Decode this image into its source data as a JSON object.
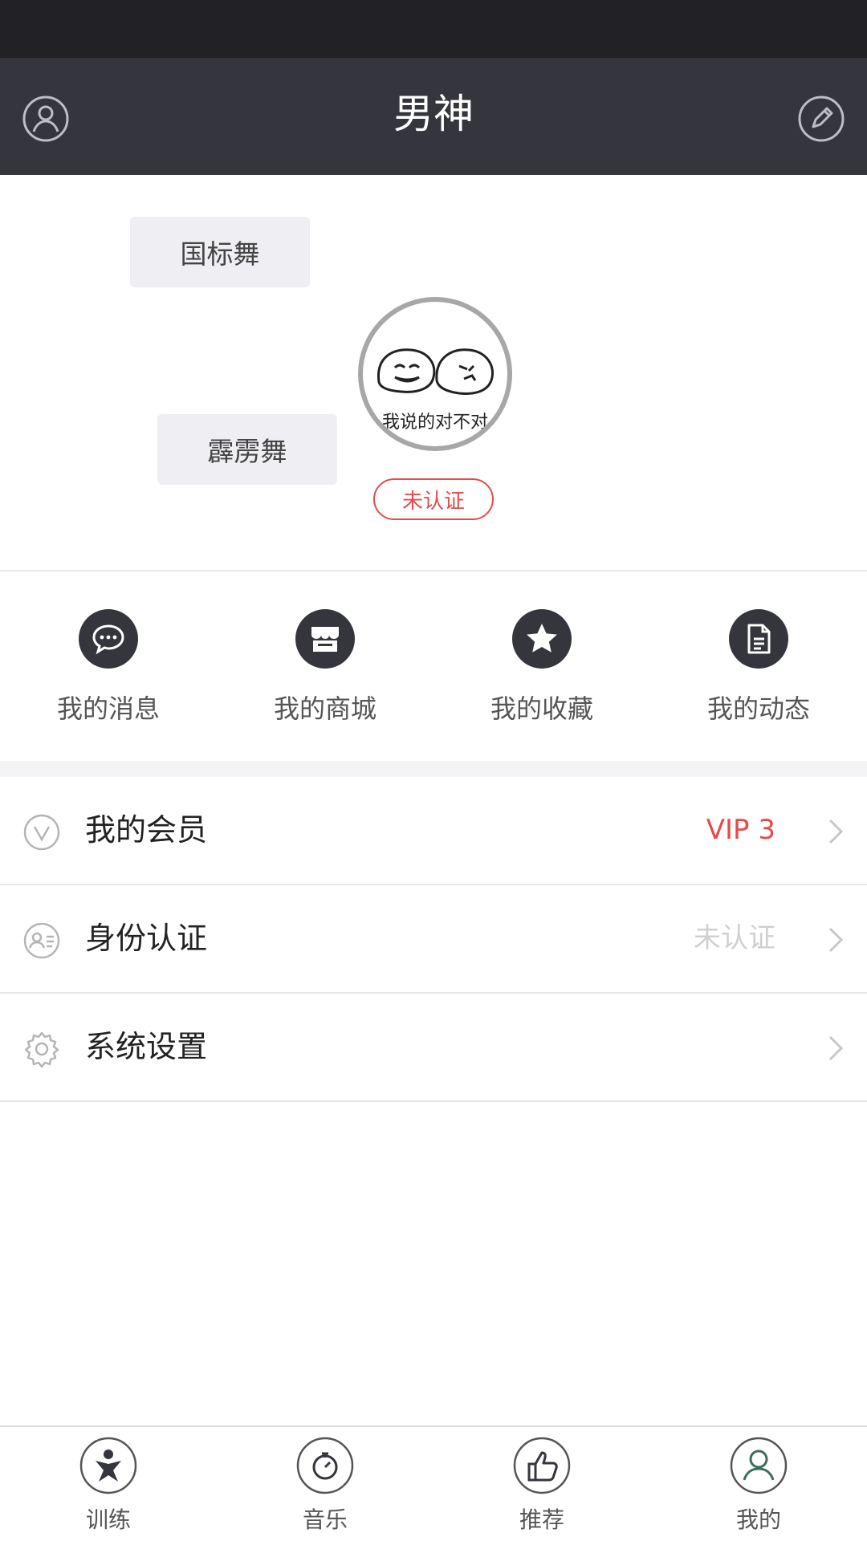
{
  "header": {
    "title": "男神",
    "left_icon": "user-icon",
    "right_icon": "edit-icon"
  },
  "profile": {
    "tags": [
      "国标舞",
      "霹雳舞"
    ],
    "avatar_caption": "我说的对不对",
    "verification_badge": "未认证"
  },
  "quick_actions": [
    {
      "label": "我的消息",
      "icon": "message-icon"
    },
    {
      "label": "我的商城",
      "icon": "store-icon"
    },
    {
      "label": "我的收藏",
      "icon": "star-icon"
    },
    {
      "label": "我的动态",
      "icon": "document-icon"
    }
  ],
  "menu": [
    {
      "label": "我的会员",
      "value": "VIP 3",
      "value_color": "#e84a4a",
      "icon": "vip-icon"
    },
    {
      "label": "身份认证",
      "value": "未认证",
      "value_color": "#d0d0d0",
      "icon": "id-card-icon"
    },
    {
      "label": "系统设置",
      "value": "",
      "icon": "gear-icon"
    }
  ],
  "tabbar": [
    {
      "label": "训练",
      "icon": "training-icon",
      "active": false
    },
    {
      "label": "音乐",
      "icon": "music-icon",
      "active": false
    },
    {
      "label": "推荐",
      "icon": "thumbs-up-icon",
      "active": false
    },
    {
      "label": "我的",
      "icon": "profile-icon",
      "active": true
    }
  ],
  "colors": {
    "nav_bg": "#34353d",
    "status_bg": "#212126",
    "accent_red": "#e84a4a"
  }
}
